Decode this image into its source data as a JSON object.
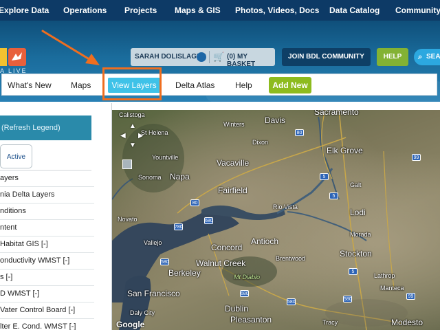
{
  "top_nav": {
    "items": [
      "Explore Data",
      "Operations",
      "Projects",
      "Maps & GIS",
      "Photos, Videos, Docs",
      "Data Catalog",
      "Community"
    ]
  },
  "header": {
    "logo_sub": "A LIVE",
    "user_name": "SARAH DOLISLAGER",
    "basket_label": "(0) MY BASKET",
    "join_button": "JOIN BDL COMMUNITY",
    "help_button": "HELP",
    "search_label": "SEAR"
  },
  "sub_nav": {
    "items": [
      "What's New",
      "Maps",
      "View Layers",
      "Delta Atlas",
      "Help",
      "Add New"
    ],
    "active": "View Layers"
  },
  "left_panel": {
    "legend_header": "(Refresh Legend)",
    "active_tab": "Active",
    "layers": [
      "ayers",
      "nia Delta Layers",
      "nditions",
      "ntent",
      " Habitat GIS [-]",
      "onductivity WMST [-]",
      "s [-]",
      "D WMST [-]",
      "Vater Control Board [-]",
      "lter E. Cond. WMST [-]"
    ]
  },
  "map": {
    "labels": {
      "calistoga": "Calistoga",
      "st_helena": "St Helena",
      "yountville": "Yountville",
      "sonoma": "Sonoma",
      "napa": "Napa",
      "vacaville": "Vacaville",
      "fairfield": "Fairfield",
      "davis": "Davis",
      "winters": "Winters",
      "dixon": "Dixon",
      "sacramento": "Sacramento",
      "elk_grove": "Elk Grove",
      "galt": "Galt",
      "lodi": "Lodi",
      "rio_vista": "Rio Vista",
      "novato": "Novato",
      "concord": "Concord",
      "antioch": "Antioch",
      "brentwood": "Brentwood",
      "walnut_creek": "Walnut Creek",
      "berkeley": "Berkeley",
      "mt_diablo": "Mt Diablo",
      "san_francisco": "San Francisco",
      "daly_city": "Daly City",
      "dublin": "Dublin",
      "pleasanton": "Pleasanton",
      "stockton": "Stockton",
      "lathrop": "Lathrop",
      "manteca": "Manteca",
      "modesto": "Modesto",
      "morada": "Morada",
      "tracy": "Tracy",
      "vallejo": "Vallejo"
    },
    "google": "Google"
  },
  "colors": {
    "top_nav_bg": "#0d3a66",
    "subnav_active": "#3fc2e8",
    "add_new": "#8dbb1e",
    "help_green": "#83b234",
    "annotation_orange": "#ef6e1f",
    "legend_header_bg": "#2a8aaa"
  }
}
